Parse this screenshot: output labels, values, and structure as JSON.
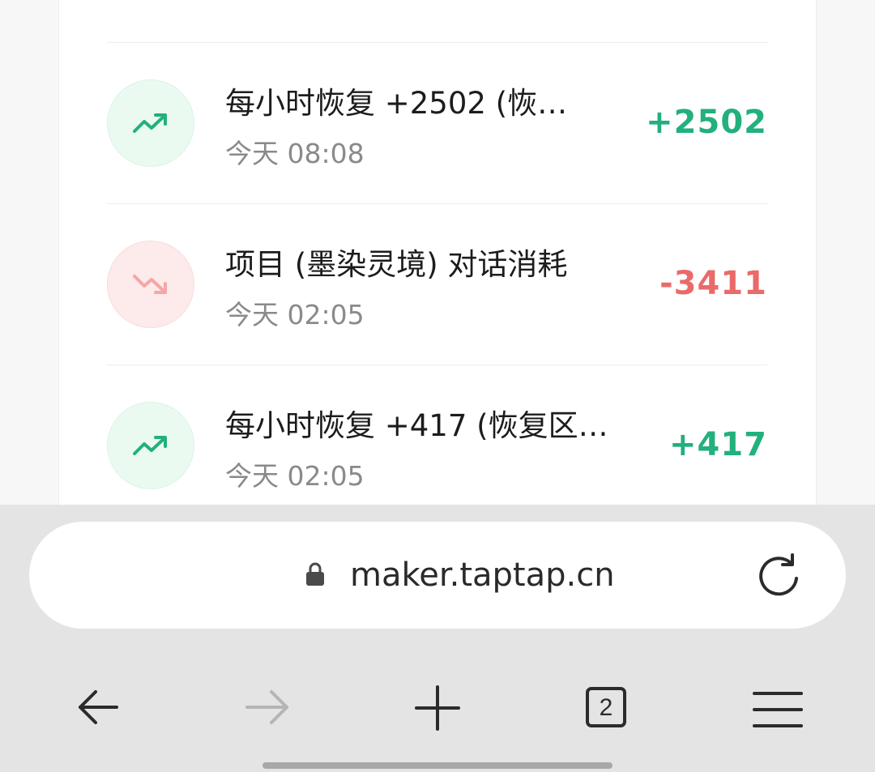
{
  "transactions": [
    {
      "direction": "up",
      "title": "每小时恢复 +2502 (恢…",
      "time": "今天 08:08",
      "amount": "+2502",
      "icon": "trend-up-icon"
    },
    {
      "direction": "down",
      "title": "项目 (墨染灵境) 对话消耗",
      "time": "今天 02:05",
      "amount": "-3411",
      "icon": "trend-down-icon"
    },
    {
      "direction": "up",
      "title": "每小时恢复 +417 (恢复区…",
      "time": "今天 02:05",
      "amount": "+417",
      "icon": "trend-up-icon"
    }
  ],
  "browser": {
    "url": "maker.taptap.cn",
    "tab_count": "2",
    "icons": {
      "lock": "lock-icon",
      "refresh": "refresh-icon",
      "back": "back-arrow-icon",
      "forward": "forward-arrow-icon",
      "new_tab": "plus-icon",
      "tabs": "tab-count-icon",
      "menu": "menu-icon"
    }
  },
  "colors": {
    "positive": "#22b07d",
    "negative": "#ea6a6a",
    "positive_bg": "#eafaf1",
    "negative_bg": "#fdeaea"
  }
}
